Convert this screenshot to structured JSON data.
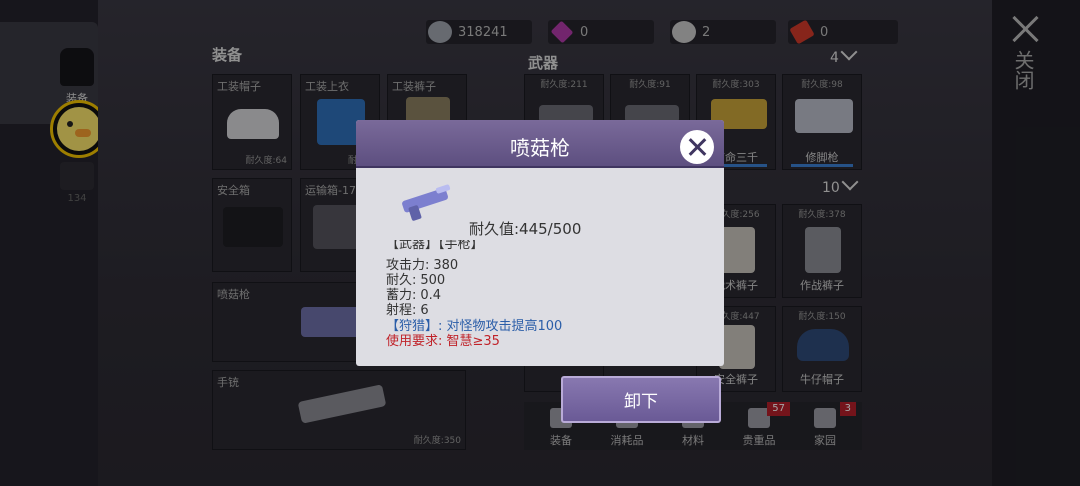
{
  "sidebar": {
    "tab_label": "装备",
    "count": "134"
  },
  "close_label": "关闭",
  "currencies": [
    {
      "icon": "coin-icon",
      "value": "318241",
      "color": "#9ea3ad"
    },
    {
      "icon": "gem-icon",
      "value": "0",
      "color": "#b03aa8"
    },
    {
      "icon": "token-icon",
      "value": "2",
      "color": "#c8c8c8"
    },
    {
      "icon": "ticket-icon",
      "value": "0",
      "color": "#d03a2a"
    }
  ],
  "equipment": {
    "title": "装备",
    "slots": [
      {
        "name": "工装帽子",
        "durability": "耐久度:64"
      },
      {
        "name": "工装上衣",
        "durability": "耐久度"
      },
      {
        "name": "工装裤子",
        "durability": ""
      },
      {
        "name": "安全箱",
        "durability": ""
      },
      {
        "name": "运输箱-17",
        "durability": "耐久"
      },
      {
        "name": "喷菇枪",
        "durability": ""
      },
      {
        "name": "手铳",
        "durability": "耐久度:350"
      }
    ]
  },
  "weapons": {
    "title": "武器",
    "count": "4",
    "items": [
      {
        "durability": "耐久度:211",
        "label": ""
      },
      {
        "durability": "耐久度:91",
        "label": ""
      },
      {
        "durability": "耐久度:303",
        "label": "南命三千"
      },
      {
        "durability": "耐久度:98",
        "label": "修脚枪"
      }
    ]
  },
  "armor": {
    "count": "10",
    "items": [
      {
        "durability": "耐久度:256",
        "label": "战术裤子"
      },
      {
        "durability": "耐久度:378",
        "label": "作战裤子"
      },
      {
        "durability": "耐久度:447",
        "label": "安全裤子"
      },
      {
        "durability": "耐久度:150",
        "label": "牛仔帽子"
      }
    ]
  },
  "tabs": [
    {
      "label": "装备",
      "badge": ""
    },
    {
      "label": "消耗品",
      "badge": ""
    },
    {
      "label": "材料",
      "badge": ""
    },
    {
      "label": "贵重品",
      "badge": "57"
    },
    {
      "label": "家园",
      "badge": "3"
    }
  ],
  "modal": {
    "title": "喷菇枪",
    "durability": "耐久值:445/500",
    "header_partial": "【武器】【手枪】",
    "stats": [
      {
        "label": "攻击力:",
        "value": "380"
      },
      {
        "label": "耐久:",
        "value": "500"
      },
      {
        "label": "蓄力:",
        "value": "0.4"
      },
      {
        "label": "射程:",
        "value": "6"
      }
    ],
    "skill": "【狩猎】: 对怪物攻击提高100",
    "requirement": "使用要求: 智慧≥35"
  },
  "unequip_label": "卸下"
}
